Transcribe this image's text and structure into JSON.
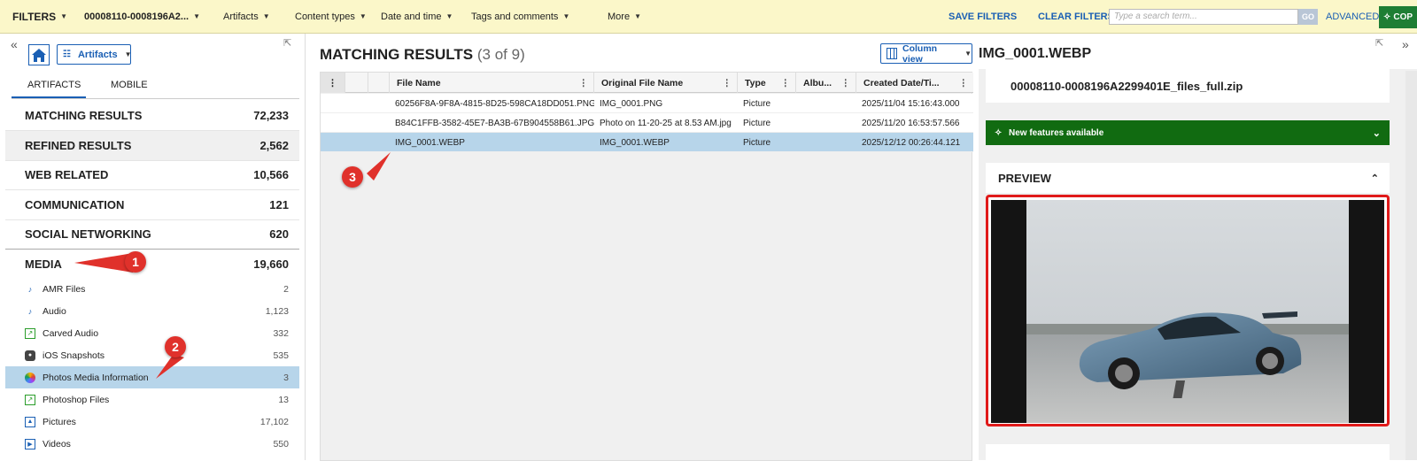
{
  "topbar": {
    "filters_label": "FILTERS",
    "case_id": "00008110-0008196A2...",
    "artifacts": "Artifacts",
    "content_types": "Content types",
    "date_time": "Date and time",
    "tags_comments": "Tags and comments",
    "more": "More",
    "save_filters": "SAVE FILTERS",
    "clear_filters": "CLEAR FILTERS",
    "search_placeholder": "Type a search term...",
    "go": "GO",
    "advanced": "ADVANCED",
    "copy": "COP"
  },
  "left": {
    "artifacts_dropdown": "Artifacts",
    "tabs": [
      "ARTIFACTS",
      "MOBILE"
    ],
    "categories": [
      {
        "label": "MATCHING RESULTS",
        "count": "72,233"
      },
      {
        "label": "REFINED RESULTS",
        "count": "2,562"
      },
      {
        "label": "WEB RELATED",
        "count": "10,566"
      },
      {
        "label": "COMMUNICATION",
        "count": "121"
      },
      {
        "label": "SOCIAL NETWORKING",
        "count": "620"
      },
      {
        "label": "MEDIA",
        "count": "19,660"
      }
    ],
    "media_items": [
      {
        "label": "AMR Files",
        "count": "2",
        "icon": "music-note-icon"
      },
      {
        "label": "Audio",
        "count": "1,123",
        "icon": "music-note-icon"
      },
      {
        "label": "Carved Audio",
        "count": "332",
        "icon": "carved-file-icon"
      },
      {
        "label": "iOS Snapshots",
        "count": "535",
        "icon": "camera-icon"
      },
      {
        "label": "Photos Media Information",
        "count": "3",
        "icon": "photos-app-icon"
      },
      {
        "label": "Photoshop Files",
        "count": "13",
        "icon": "image-file-icon"
      },
      {
        "label": "Pictures",
        "count": "17,102",
        "icon": "picture-icon"
      },
      {
        "label": "Videos",
        "count": "550",
        "icon": "video-icon"
      }
    ]
  },
  "middle": {
    "title": "MATCHING RESULTS",
    "subtitle": "(3 of 9)",
    "column_view": "Column view",
    "columns": [
      "File Name",
      "Original File Name",
      "Type",
      "Albu...",
      "Created Date/Ti..."
    ],
    "rows": [
      {
        "file": "60256F8A-9F8A-4815-8D25-598CA18DD051.PNG",
        "original": "IMG_0001.PNG",
        "type": "Picture",
        "album": "",
        "created": "2025/11/04 15:16:43.000"
      },
      {
        "file": "B84C1FFB-3582-45E7-BA3B-67B904558B61.JPG",
        "original": "Photo on 11-20-25 at 8.53 AM.jpg",
        "type": "Picture",
        "album": "",
        "created": "2025/11/20 16:53:57.566"
      },
      {
        "file": "IMG_0001.WEBP",
        "original": "IMG_0001.WEBP",
        "type": "Picture",
        "album": "",
        "created": "2025/12/12 00:26:44.121"
      }
    ]
  },
  "right": {
    "file_title": "IMG_0001.WEBP",
    "zip_name": "00008110-0008196A2299401E_files_full.zip",
    "new_features": "New features available",
    "preview": "PREVIEW"
  },
  "annotations": [
    "1",
    "2",
    "3"
  ],
  "colors": {
    "accent": "#1a5fb4",
    "selected_row": "#b7d5ea",
    "annotation": "#e0312b",
    "banner": "#116b11"
  }
}
